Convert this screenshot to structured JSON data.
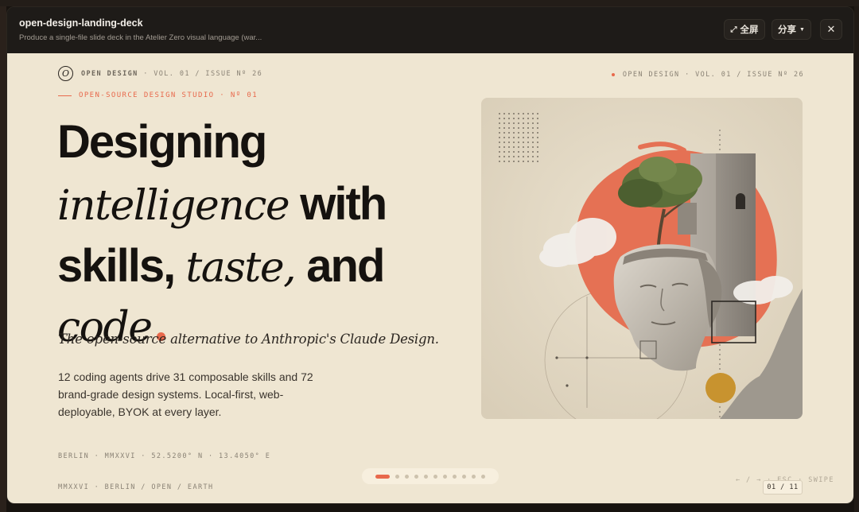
{
  "window": {
    "title": "open-design-landing-deck",
    "subtitle": "Produce a single-file slide deck in the Atelier Zero visual language (war...",
    "fullscreen_label": "全屏",
    "share_label": "分享",
    "close_label": "✕"
  },
  "slide": {
    "logo_glyph": "O",
    "masthead_brand": "OPEN DESIGN",
    "masthead_issue": " · VOL. 01 / ISSUE Nº 26",
    "masthead_right": "OPEN DESIGN · VOL. 01 / ISSUE Nº 26",
    "kicker": "OPEN-SOURCE DESIGN STUDIO · Nº 01",
    "headline": {
      "line1": "Designing",
      "line2_italic": "intelligence",
      "line2_rest": " with",
      "line3_start": "skills, ",
      "line3_italic": "taste,",
      "line3_end": " and",
      "line4_italic": "code"
    },
    "tagline": "The open-source alternative to Anthropic's Claude Design.",
    "body": "12 coding agents drive 31 composable skills and 72 brand-grade design systems. Local-first, web-deployable, BYOK at every layer.",
    "coordinates": "BERLIN · MMXXVI · 52.5200° N · 13.4050° E",
    "footer_left": "MMXXVI · BERLIN / OPEN / EARTH",
    "nav_hint": "← / → · ESC · SWIPE",
    "counter": "01 / 11"
  },
  "pager": {
    "total": 11,
    "current": 1
  },
  "colors": {
    "accent": "#e8694c",
    "paper": "#efe6d2",
    "ink": "#15120f",
    "mustard": "#c8932f"
  },
  "icons": {
    "fullscreen": "expand-arrows-icon",
    "share_caret": "caret-down-icon",
    "close": "close-icon"
  }
}
